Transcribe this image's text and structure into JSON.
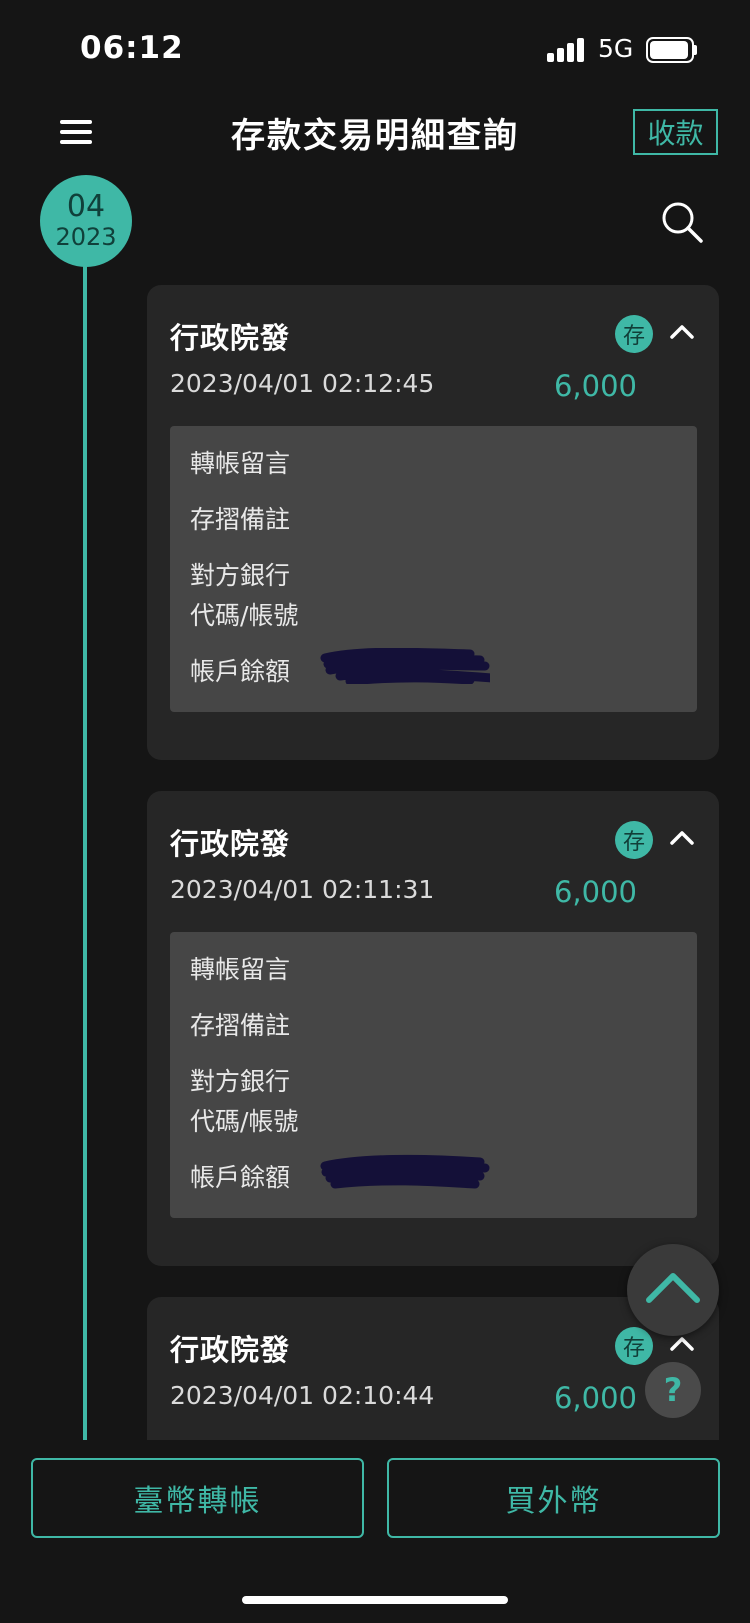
{
  "status_bar": {
    "time": "06:12",
    "network": "5G"
  },
  "header": {
    "title": "存款交易明細查詢",
    "collect_label": "收款"
  },
  "timeline": {
    "month": "04",
    "year": "2023"
  },
  "transactions": [
    {
      "name": "行政院發",
      "datetime": "2023/04/01 02:12:45",
      "amount": "6,000",
      "badge": "存",
      "fields": {
        "message": "轉帳留言",
        "memo": "存摺備註",
        "bank_line1": "對方銀行",
        "bank_line2": "代碼/帳號",
        "balance": "帳戶餘額"
      }
    },
    {
      "name": "行政院發",
      "datetime": "2023/04/01 02:11:31",
      "amount": "6,000",
      "badge": "存",
      "fields": {
        "message": "轉帳留言",
        "memo": "存摺備註",
        "bank_line1": "對方銀行",
        "bank_line2": "代碼/帳號",
        "balance": "帳戶餘額"
      }
    },
    {
      "name": "行政院發",
      "datetime": "2023/04/01 02:10:44",
      "amount": "6,000",
      "badge": "存"
    }
  ],
  "help_label": "?",
  "bottom_actions": {
    "twd_transfer": "臺幣轉帳",
    "buy_fx": "買外幣"
  },
  "colors": {
    "accent": "#3fb8a6",
    "background": "#151515",
    "card": "#262626",
    "detail": "#464646"
  }
}
